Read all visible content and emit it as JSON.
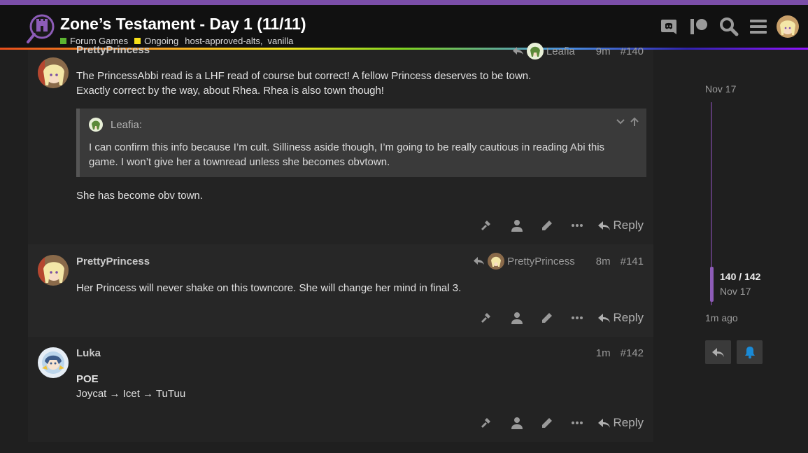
{
  "topic": {
    "title": "Zone’s Testament - Day 1 (11/11)",
    "category": {
      "name": "Forum Games",
      "color": "#5cb531"
    },
    "subcategory": {
      "name": "Ongoing",
      "color": "#f7e019"
    },
    "tags": [
      "host-approved-alts,",
      "vanilla"
    ]
  },
  "header": {
    "icons": [
      "discord-icon",
      "patreon-icon",
      "search-icon",
      "hamburger-menu-icon",
      "user-avatar"
    ]
  },
  "posts": [
    {
      "username": "PrettyPrincess",
      "reply_to": "Leafia",
      "age": "9m",
      "number": "#140",
      "paragraphs": [
        "The PrincessAbbi read is a LHF read of course but correct! A fellow Princess deserves to be town.",
        "Exactly correct by the way, about Rhea. Rhea is also town though!"
      ],
      "quote": {
        "author": "Leafia:",
        "lines": [
          "I can confirm this info because I’m cult. Silliness aside though, I’m going to be really cautious in reading Abi this",
          "game. I won’t give her a townread unless she becomes obvtown."
        ]
      },
      "after_quote": "She has become obv town.",
      "reply_label": "Reply"
    },
    {
      "username": "PrettyPrincess",
      "reply_to": "PrettyPrincess",
      "age": "8m",
      "number": "#141",
      "paragraphs": [
        "Her Princess will never shake on this towncore. She will change her mind in final 3."
      ],
      "reply_label": "Reply"
    },
    {
      "username": "Luka",
      "age": "1m",
      "number": "#142",
      "bold_line": "POE",
      "line": "Joycat → Icet → TuTuu",
      "reply_label": "Reply"
    }
  ],
  "timeline": {
    "start_date": "Nov 17",
    "position": "140 / 142",
    "position_date": "Nov 17",
    "last_activity": "1m ago",
    "progress_fraction": 0.986
  },
  "colors": {
    "accent": "#8d5cb8",
    "header_bg": "#111111",
    "post_bg_alt": "#272727",
    "post_bg": "#232323",
    "notification_blue": "#1a8ad6"
  }
}
